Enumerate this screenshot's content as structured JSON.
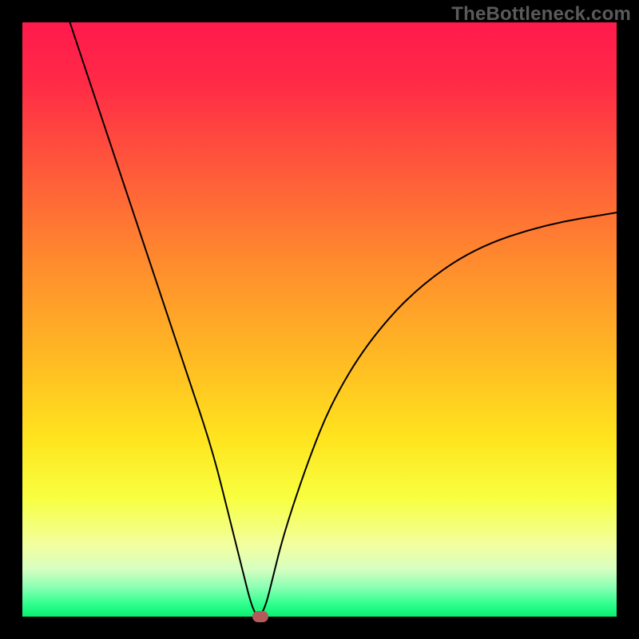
{
  "watermark": "TheBottleneck.com",
  "chart_data": {
    "type": "line",
    "title": "",
    "xlabel": "",
    "ylabel": "",
    "xlim": [
      0,
      100
    ],
    "ylim": [
      0,
      100
    ],
    "grid": false,
    "series": [
      {
        "name": "curve",
        "x": [
          8,
          12,
          16,
          20,
          24,
          28,
          32,
          35,
          37,
          38.5,
          39.5,
          40,
          41,
          42,
          44,
          48,
          52,
          58,
          66,
          76,
          88,
          100
        ],
        "y": [
          100,
          88,
          76,
          64,
          52,
          40,
          28,
          16,
          8,
          2,
          0,
          0,
          2,
          6,
          14,
          26,
          36,
          46,
          55,
          62,
          66,
          68
        ]
      }
    ],
    "marker": {
      "x": 40,
      "y": 0,
      "color": "#b55a5a"
    },
    "gradient_stops": [
      {
        "pos": 0,
        "color": "#ff1a4d"
      },
      {
        "pos": 25,
        "color": "#ff5a3a"
      },
      {
        "pos": 55,
        "color": "#ffb524"
      },
      {
        "pos": 80,
        "color": "#f8ff40"
      },
      {
        "pos": 95,
        "color": "#8cffb4"
      },
      {
        "pos": 100,
        "color": "#08f070"
      }
    ]
  }
}
